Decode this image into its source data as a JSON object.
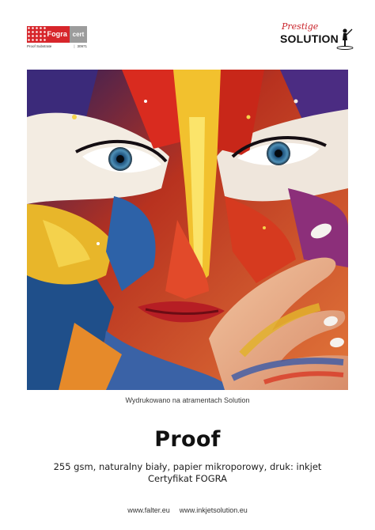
{
  "logos": {
    "fogra": {
      "name": "Fogra",
      "badge": "cert",
      "subtitle": "Proof Substrate",
      "number": "30971",
      "color": "#d7262b"
    },
    "prestige": {
      "script": "Prestige",
      "word": "SOLUTION",
      "color": "#c9232a"
    }
  },
  "photo": {
    "icon": "painted-face-photo"
  },
  "caption": "Wydrukowano na atramentach Solution",
  "title": "Proof",
  "description": {
    "line1": "255 gsm, naturalny biały, papier mikroporowy, druk: inkjet",
    "line2": "Certyfikat FOGRA"
  },
  "footer": {
    "link1": "www.falter.eu",
    "link2": "www.inkjetsolution.eu"
  }
}
